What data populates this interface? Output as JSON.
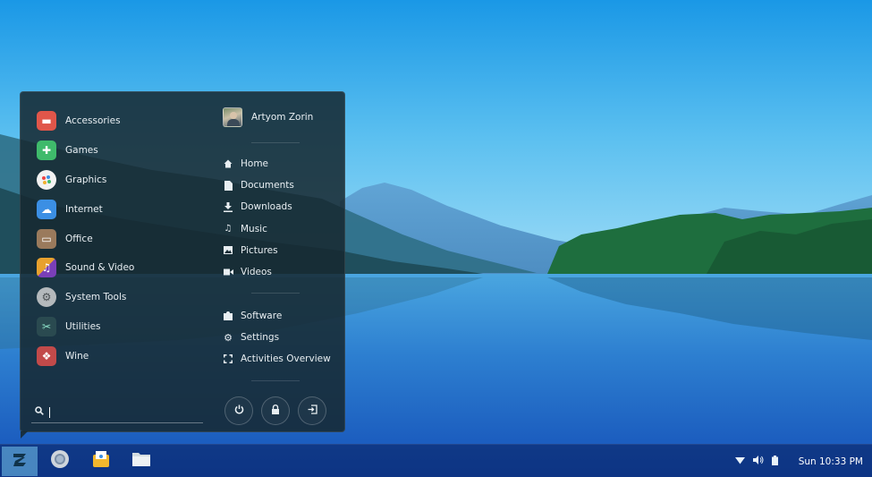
{
  "menu": {
    "categories": [
      {
        "label": "Accessories",
        "icon": "accessories-icon",
        "color": "#e0564a"
      },
      {
        "label": "Games",
        "icon": "gamepad-icon",
        "color": "#3fba6b"
      },
      {
        "label": "Graphics",
        "icon": "palette-icon",
        "color": "#f2f2f2"
      },
      {
        "label": "Internet",
        "icon": "cloud-icon",
        "color": "#3b8fe4"
      },
      {
        "label": "Office",
        "icon": "briefcase-icon",
        "color": "#9a7a5c"
      },
      {
        "label": "Sound & Video",
        "icon": "music-video-icon",
        "color": "#e8a12e"
      },
      {
        "label": "System Tools",
        "icon": "gear-icon",
        "color": "#b4b9bc"
      },
      {
        "label": "Utilities",
        "icon": "utilities-icon",
        "color": "#58a6a0"
      },
      {
        "label": "Wine",
        "icon": "wine-icon",
        "color": "#c24a4a"
      }
    ],
    "user": {
      "name": "Artyom Zorin"
    },
    "places": [
      {
        "label": "Home",
        "icon": "home-icon"
      },
      {
        "label": "Documents",
        "icon": "document-icon"
      },
      {
        "label": "Downloads",
        "icon": "download-icon"
      },
      {
        "label": "Music",
        "icon": "music-note-icon"
      },
      {
        "label": "Pictures",
        "icon": "picture-icon"
      },
      {
        "label": "Videos",
        "icon": "video-camera-icon"
      }
    ],
    "system": [
      {
        "label": "Software",
        "icon": "software-bag-icon"
      },
      {
        "label": "Settings",
        "icon": "settings-gear-icon"
      },
      {
        "label": "Activities Overview",
        "icon": "overview-corners-icon"
      }
    ],
    "search": {
      "value": "",
      "placeholder": ""
    },
    "power_buttons": [
      "power-icon",
      "lock-icon",
      "logout-icon"
    ]
  },
  "taskbar": {
    "clock": "Sun 10:33 PM",
    "tray_icons": [
      "wifi-icon",
      "volume-icon",
      "battery-icon"
    ],
    "apps": [
      "chromium-icon",
      "mail-icon",
      "files-icon"
    ]
  },
  "colors": {
    "menu_bg": "#162830",
    "taskbar_bg": "#081e5a",
    "accent": "#78c8f0"
  }
}
